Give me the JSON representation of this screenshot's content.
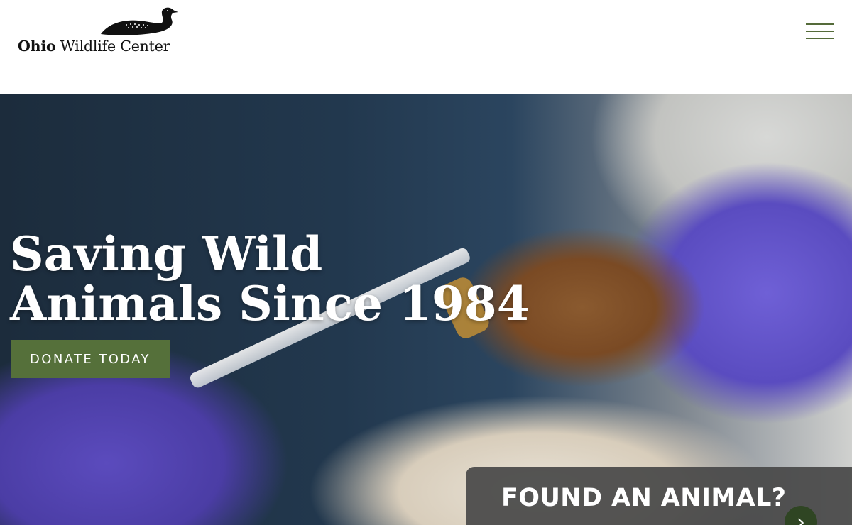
{
  "header": {
    "logo": {
      "name": "Ohio Wildlife Center",
      "name_bold": "Ohio",
      "name_regular": "Wildlife Center",
      "icon": "loon-icon"
    },
    "menu": {
      "icon": "hamburger-menu-icon",
      "color": "#556b3a"
    }
  },
  "hero": {
    "title": "Saving Wild Animals Since 1984",
    "image_description": "",
    "donate_label": "DONATE TODAY",
    "donate_color": "#55703a"
  },
  "found_animal": {
    "label": "FOUND AN ANIMAL?",
    "arrow_icon": "chevron-right-icon",
    "arrow_color": "#2f4523"
  }
}
